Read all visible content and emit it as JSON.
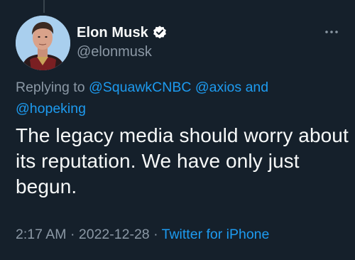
{
  "author": {
    "display_name": "Elon Musk",
    "handle": "@elonmusk",
    "verified": true
  },
  "reply": {
    "prefix": "Replying to",
    "mention_1": "@SquawkCNBC",
    "mention_2": "@axios",
    "conjunction": "and",
    "mention_3": "@hopeking"
  },
  "tweet": {
    "text": "The legacy media should worry about its reputation. We have only just begun."
  },
  "meta": {
    "time": "2:17 AM",
    "separator": "·",
    "date": "2022-12-28",
    "source": "Twitter for iPhone"
  },
  "colors": {
    "background": "#15202b",
    "accent": "#1d9bf0",
    "text": "#f7f9f9",
    "secondary": "#8b98a5"
  },
  "icons": {
    "verified": "verified-badge-icon",
    "more": "more-options-icon"
  }
}
